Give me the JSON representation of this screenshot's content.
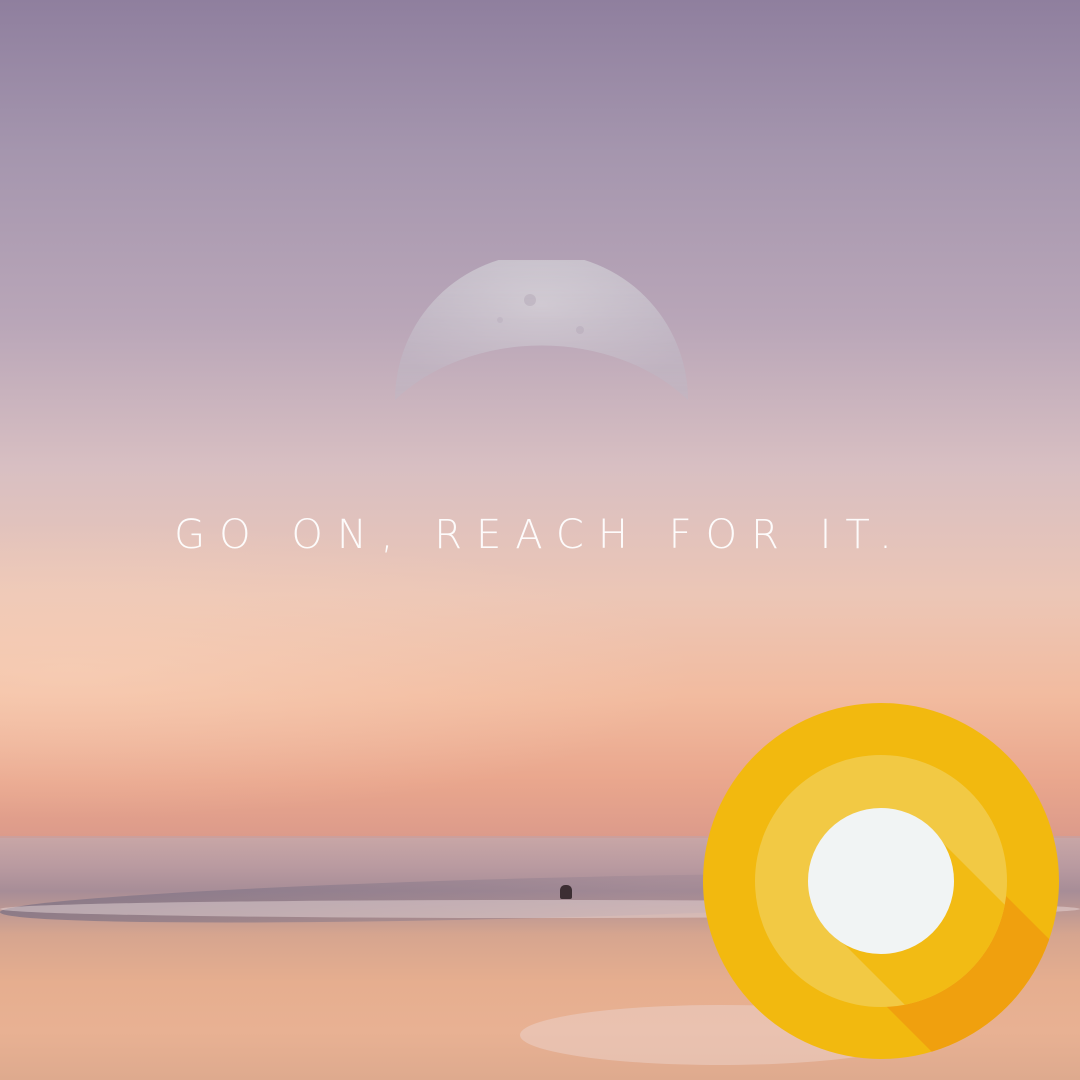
{
  "tagline": "GO ON, REACH FOR IT.",
  "colors": {
    "logo_outer": "#f2b90f",
    "logo_middle": "#f2c944",
    "logo_inner": "#f1f4f4",
    "logo_shadow": "#f0a00e",
    "tagline": "#ffffff"
  },
  "icons": {
    "moon": "crescent-moon-icon",
    "logo": "android-oreo-logo-icon"
  }
}
